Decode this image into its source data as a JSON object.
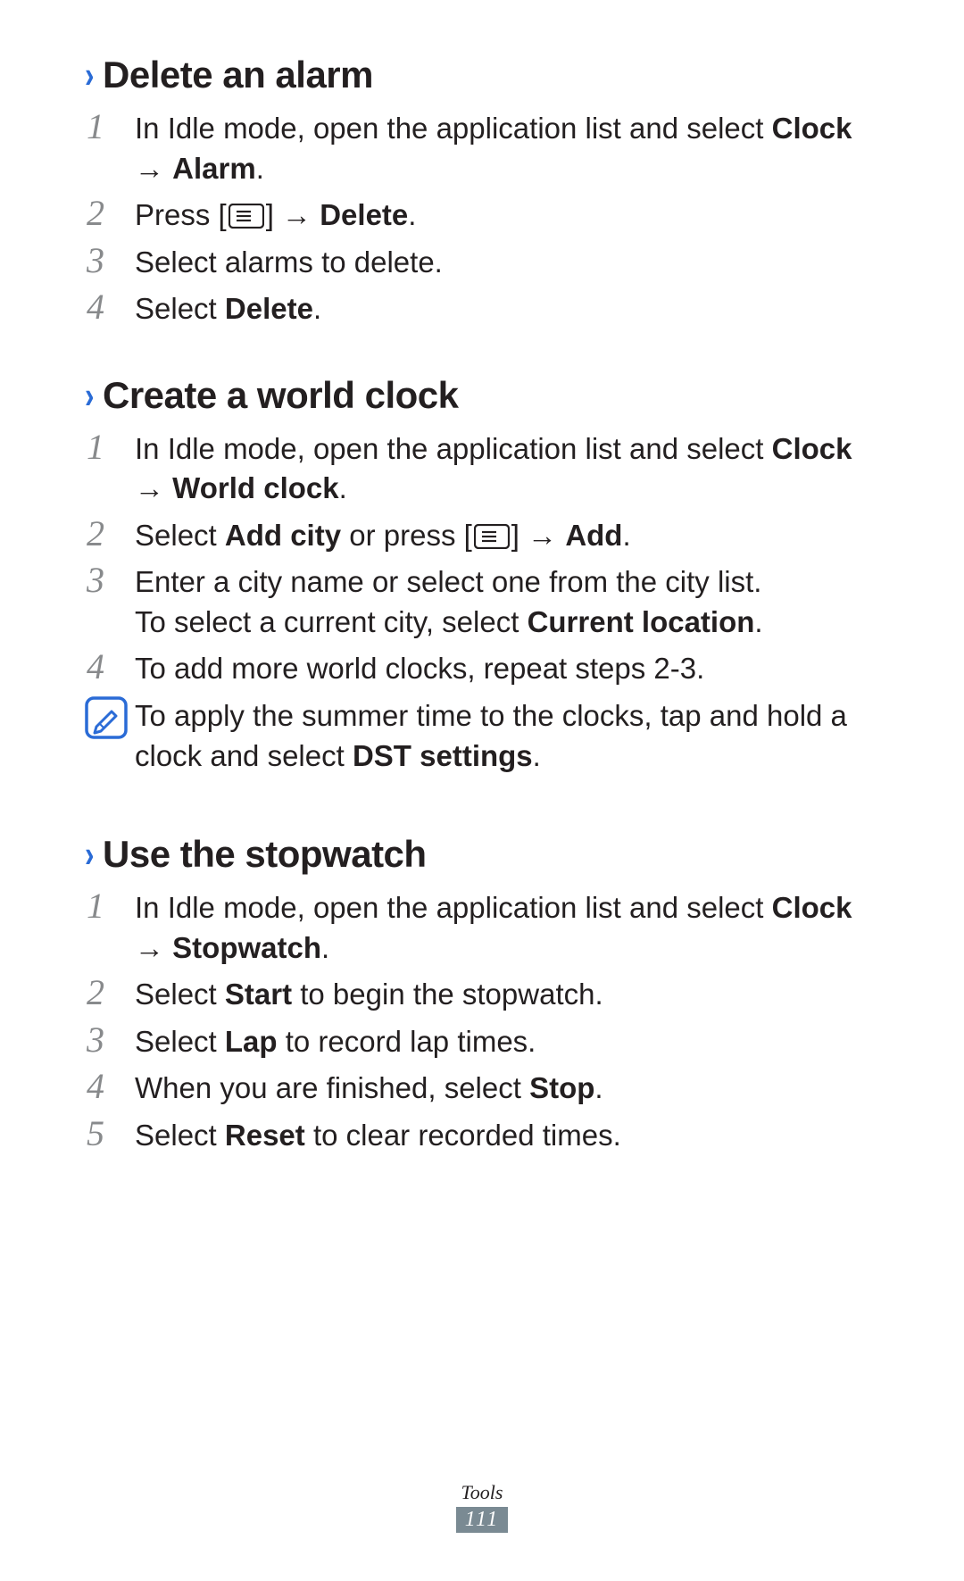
{
  "sections": [
    {
      "heading": "Delete an alarm",
      "steps": [
        {
          "num": "1",
          "pre": "In Idle mode, open the application list and select ",
          "b1": "Clock",
          "mid": " → ",
          "b2": "Alarm",
          "post": "."
        },
        {
          "num": "2",
          "pre": "Press [",
          "icon": true,
          "mid2": "] → ",
          "b1": "Delete",
          "post": "."
        },
        {
          "num": "3",
          "pre": "Select alarms to delete."
        },
        {
          "num": "4",
          "pre": "Select ",
          "b1": "Delete",
          "post": "."
        }
      ]
    },
    {
      "heading": "Create a world clock",
      "steps": [
        {
          "num": "1",
          "pre": "In Idle mode, open the application list and select ",
          "b1": "Clock",
          "mid": " → ",
          "b2": "World clock",
          "post": "."
        },
        {
          "num": "2",
          "pre": "Select ",
          "b1": "Add city",
          "mid": " or press [",
          "icon": true,
          "mid2": "] → ",
          "b2": "Add",
          "post": "."
        },
        {
          "num": "3",
          "pre": "Enter a city name or select one from the city list.",
          "line2_pre": "To select a current city, select ",
          "line2_b": "Current location",
          "line2_post": "."
        },
        {
          "num": "4",
          "pre": "To add more world clocks, repeat steps 2-3."
        }
      ],
      "note": {
        "pre": "To apply the summer time to the clocks, tap and hold a clock and select ",
        "b1": "DST settings",
        "post": "."
      }
    },
    {
      "heading": "Use the stopwatch",
      "steps": [
        {
          "num": "1",
          "pre": "In Idle mode, open the application list and select ",
          "b1": "Clock",
          "mid": " → ",
          "b2": "Stopwatch",
          "post": "."
        },
        {
          "num": "2",
          "pre": "Select ",
          "b1": "Start",
          "post": " to begin the stopwatch."
        },
        {
          "num": "3",
          "pre": "Select ",
          "b1": "Lap",
          "post": " to record lap times."
        },
        {
          "num": "4",
          "pre": "When you are finished, select ",
          "b1": "Stop",
          "post": "."
        },
        {
          "num": "5",
          "pre": "Select ",
          "b1": "Reset",
          "post": " to clear recorded times."
        }
      ]
    }
  ],
  "footer": {
    "category": "Tools",
    "page": "111"
  }
}
